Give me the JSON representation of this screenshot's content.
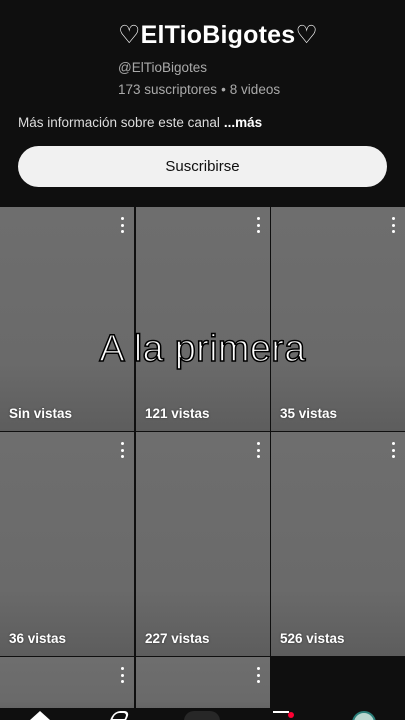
{
  "channel": {
    "name": "♡ElTioBigotes♡",
    "handle": "@ElTioBigotes",
    "subscribers": "173 suscriptores",
    "separator": "•",
    "video_count": "8 videos",
    "more_info": "Más información sobre este canal",
    "more_link": "...más"
  },
  "subscribe_label": "Suscribirse",
  "overlay_text": "A la primera",
  "videos": [
    {
      "views": "Sin vistas"
    },
    {
      "views": "121 vistas"
    },
    {
      "views": "35 vistas"
    },
    {
      "views": "36 vistas"
    },
    {
      "views": "227 vistas"
    },
    {
      "views": "526 vistas"
    }
  ],
  "colors": {
    "background": "#0f0f0f",
    "button_bg": "#f1f1f1",
    "tile_bg": "#6e6e6e",
    "notification_dot": "#ff0033"
  },
  "icons": {
    "tile_menu": "more-vert-icon",
    "nav": [
      "home-icon",
      "shorts-icon",
      "create-icon",
      "subscriptions-icon",
      "avatar-icon"
    ]
  }
}
